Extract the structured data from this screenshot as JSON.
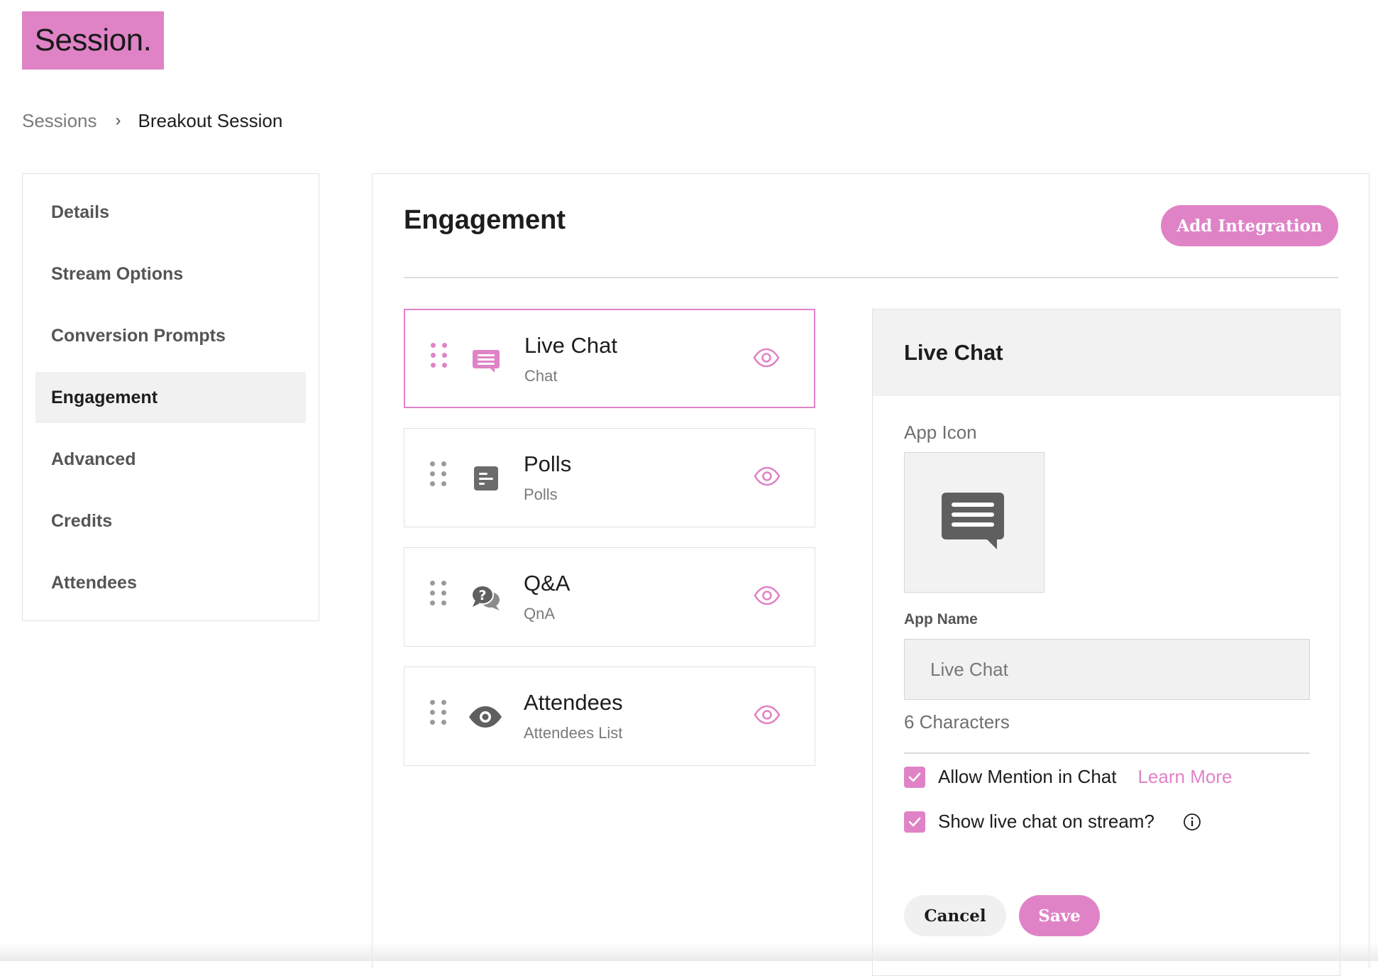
{
  "logo": {
    "text": "Session."
  },
  "breadcrumb": {
    "parent": "Sessions",
    "separator": "›",
    "current": "Breakout Session"
  },
  "sidebar": {
    "items": [
      {
        "label": "Details"
      },
      {
        "label": "Stream Options"
      },
      {
        "label": "Conversion Prompts"
      },
      {
        "label": "Engagement",
        "active": true
      },
      {
        "label": "Advanced"
      },
      {
        "label": "Credits"
      },
      {
        "label": "Attendees"
      }
    ]
  },
  "main": {
    "title": "Engagement",
    "add_button": "Add Integration"
  },
  "integrations": [
    {
      "name": "Live Chat",
      "subtitle": "Chat",
      "icon": "chat-bubble-icon",
      "selected": true
    },
    {
      "name": "Polls",
      "subtitle": "Polls",
      "icon": "poll-icon"
    },
    {
      "name": "Q&A",
      "subtitle": "QnA",
      "icon": "question-bubble-icon"
    },
    {
      "name": "Attendees",
      "subtitle": "Attendees List",
      "icon": "eye-icon"
    }
  ],
  "detail": {
    "title": "Live Chat",
    "app_icon_label": "App Icon",
    "app_icon": "chat-bubble-icon",
    "app_name_label": "App Name",
    "app_name_value": "Live Chat",
    "char_count": "6 Characters",
    "allow_mention_label": "Allow Mention in Chat",
    "allow_mention_checked": true,
    "learn_more": "Learn More",
    "show_on_stream_label": "Show live chat on stream?",
    "show_on_stream_checked": true,
    "cancel": "Cancel",
    "save": "Save"
  },
  "colors": {
    "accent": "#e083c6",
    "panel": "#f2f2f2",
    "muted": "#7a7a7a",
    "icon_gray": "#6b6b6b"
  }
}
